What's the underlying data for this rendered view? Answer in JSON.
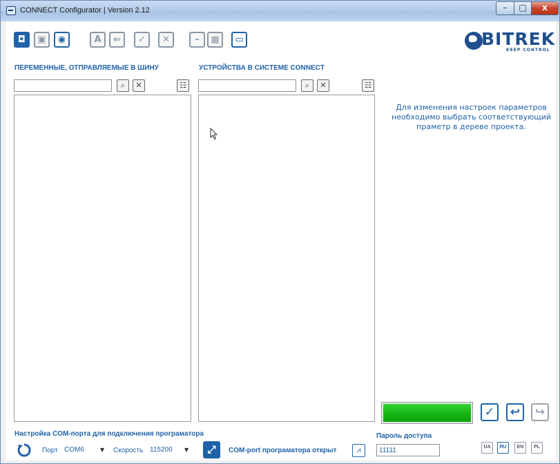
{
  "window": {
    "title": "CONNECT Configurator | Version 2.12",
    "controls": {
      "minimize": "–",
      "maximize": "□",
      "close": "x"
    }
  },
  "toolbar": [
    {
      "name": "open-file",
      "glyph": "◘"
    },
    {
      "name": "save-file",
      "glyph": "▣"
    },
    {
      "name": "view",
      "glyph": "◉"
    },
    {
      "name": "text",
      "glyph": "A"
    },
    {
      "name": "back",
      "glyph": "⇐"
    },
    {
      "name": "check",
      "glyph": "✓"
    },
    {
      "name": "close",
      "glyph": "✕"
    },
    {
      "name": "minus",
      "glyph": "–"
    },
    {
      "name": "chip",
      "glyph": "▦"
    },
    {
      "name": "monitor",
      "glyph": "▭"
    }
  ],
  "logo": {
    "brand": "BITREK",
    "tagline": "KEEP CONTROL"
  },
  "left_panel": {
    "title": "ПЕРЕМЕННЫЕ, ОТПРАВЛЯЕМЫЕ В ШИНУ",
    "search_value": "",
    "items": []
  },
  "middle_panel": {
    "title": "УСТРОЙСТВА В СИСТЕМЕ CONNECT",
    "search_value": "",
    "items": []
  },
  "info": {
    "message": "Для изменения настроек параметров необходимо выбрать соответствующий праметр в дереве проекта."
  },
  "progress": {
    "value": 1.0,
    "color": "#14b814"
  },
  "com_settings": {
    "title": "Настройка COM-порта для подключения програматора",
    "port_label": "Порт",
    "port_value": "COM6",
    "speed_label": "Скорость",
    "speed_value": "115200",
    "status": "COM-port програматора открыт"
  },
  "password": {
    "label": "Пароль доступа",
    "value": "11111"
  },
  "languages": [
    {
      "code": "UA",
      "active": false
    },
    {
      "code": "RU",
      "active": true
    },
    {
      "code": "EN",
      "active": false
    },
    {
      "code": "PL",
      "active": false
    }
  ],
  "colors": {
    "accent": "#1f62a8",
    "progress": "#14b814"
  }
}
